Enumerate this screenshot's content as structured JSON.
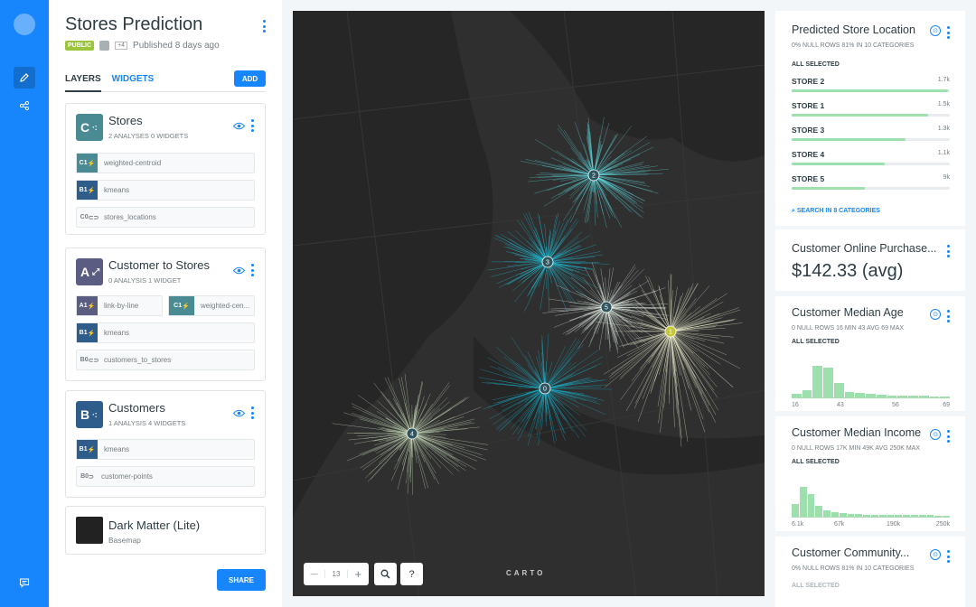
{
  "app": {
    "title": "Stores Prediction",
    "badge": "PUBLIC",
    "collaborators": "+4",
    "published": "Published 8 days ago"
  },
  "tabs": [
    {
      "label": "LAYERS"
    },
    {
      "label": "WIDGETS"
    }
  ],
  "add_label": "ADD",
  "share_label": "SHARE",
  "layers": [
    {
      "letter": "C",
      "name": "Stores",
      "meta": "2 ANALYSES   0 WIDGETS",
      "color": "#4a8a93",
      "nodes": [
        {
          "id": "C1",
          "label": "weighted-centroid",
          "color": "#4a8a93"
        },
        {
          "id": "B1",
          "label": "kmeans",
          "color": "#2e5d8c"
        },
        {
          "id": "C0",
          "label": "stores_locations"
        }
      ]
    },
    {
      "letter": "A",
      "name": "Customer to Stores",
      "meta": "0 ANALYSIS   1 WIDGET",
      "color": "#5a5c82",
      "nodes": [
        {
          "id": "A1",
          "label": "link-by-line",
          "color": "#5a5c82"
        },
        {
          "id": "C1",
          "label": "weighted-cen...",
          "color": "#4a8a93"
        },
        {
          "id": "B1",
          "label": "kmeans",
          "color": "#2e5d8c"
        },
        {
          "id": "B0",
          "label": "customers_to_stores"
        }
      ]
    },
    {
      "letter": "B",
      "name": "Customers",
      "meta": "1 ANALYSIS   4 WIDGETS",
      "color": "#2e5d8c",
      "nodes": [
        {
          "id": "B1",
          "label": "kmeans",
          "color": "#2e5d8c"
        },
        {
          "id": "B0",
          "label": "customer-points"
        }
      ]
    }
  ],
  "basemap": {
    "name": "Dark Matter (Lite)",
    "type": "Basemap"
  },
  "map": {
    "zoom": "13",
    "search_icon": "magnifier-icon",
    "help": "?",
    "attribution": "CARTO",
    "clusters": [
      {
        "label": "2",
        "color": "#5fe3ea"
      },
      {
        "label": "3",
        "color": "#1ec9e6"
      },
      {
        "label": "5",
        "color": "#e8f4ec"
      },
      {
        "label": "1",
        "color": "#f6f7d6"
      },
      {
        "label": "0",
        "color": "#16b9d6"
      },
      {
        "label": "4",
        "color": "#d9f0c9"
      }
    ]
  },
  "widgets": {
    "predicted": {
      "title": "Predicted Store Location",
      "meta": "0% NULL ROWS    81% IN 10 CATEGORIES",
      "selected": "ALL SELECTED",
      "items": [
        {
          "label": "STORE 2",
          "value": "1.7k",
          "pct": 0.99
        },
        {
          "label": "STORE 1",
          "value": "1.5k",
          "pct": 0.86
        },
        {
          "label": "STORE 3",
          "value": "1.3k",
          "pct": 0.72
        },
        {
          "label": "STORE  4",
          "value": "1.1k",
          "pct": 0.59
        },
        {
          "label": "STORE 5",
          "value": "9k",
          "pct": 0.46
        }
      ],
      "search": "SEARCH IN 8 CATEGORIES"
    },
    "purchase": {
      "title": "Customer Online Purchase...",
      "value": "$142.33 (avg)"
    },
    "age": {
      "title": "Customer Median Age",
      "meta": "0 NULL ROWS    16 MIN    43 AVG    69 MAX",
      "selected": "ALL SELECTED",
      "bins": [
        0.1,
        0.2,
        0.9,
        0.85,
        0.4,
        0.15,
        0.12,
        0.1,
        0.08,
        0.06,
        0.05,
        0.04,
        0.04,
        0.03,
        0.03
      ],
      "ticks": [
        "16",
        "43",
        "56",
        "69"
      ]
    },
    "income": {
      "title": "Customer Median Income",
      "meta": "0 NULL ROWS    17K MIN    49K AVG    250K MAX",
      "selected": "ALL SELECTED",
      "bins": [
        0.35,
        0.85,
        0.65,
        0.3,
        0.18,
        0.12,
        0.1,
        0.08,
        0.07,
        0.06,
        0.06,
        0.05,
        0.05,
        0.05,
        0.04,
        0.04,
        0.04,
        0.04,
        0.03,
        0.03
      ],
      "ticks": [
        "6.1k",
        "67k",
        "190k",
        "250k"
      ]
    },
    "community": {
      "title": "Customer Community...",
      "meta": "0% NULL ROWS    81% IN 10 CATEGORIES",
      "selected": "ALL SELECTED"
    }
  }
}
